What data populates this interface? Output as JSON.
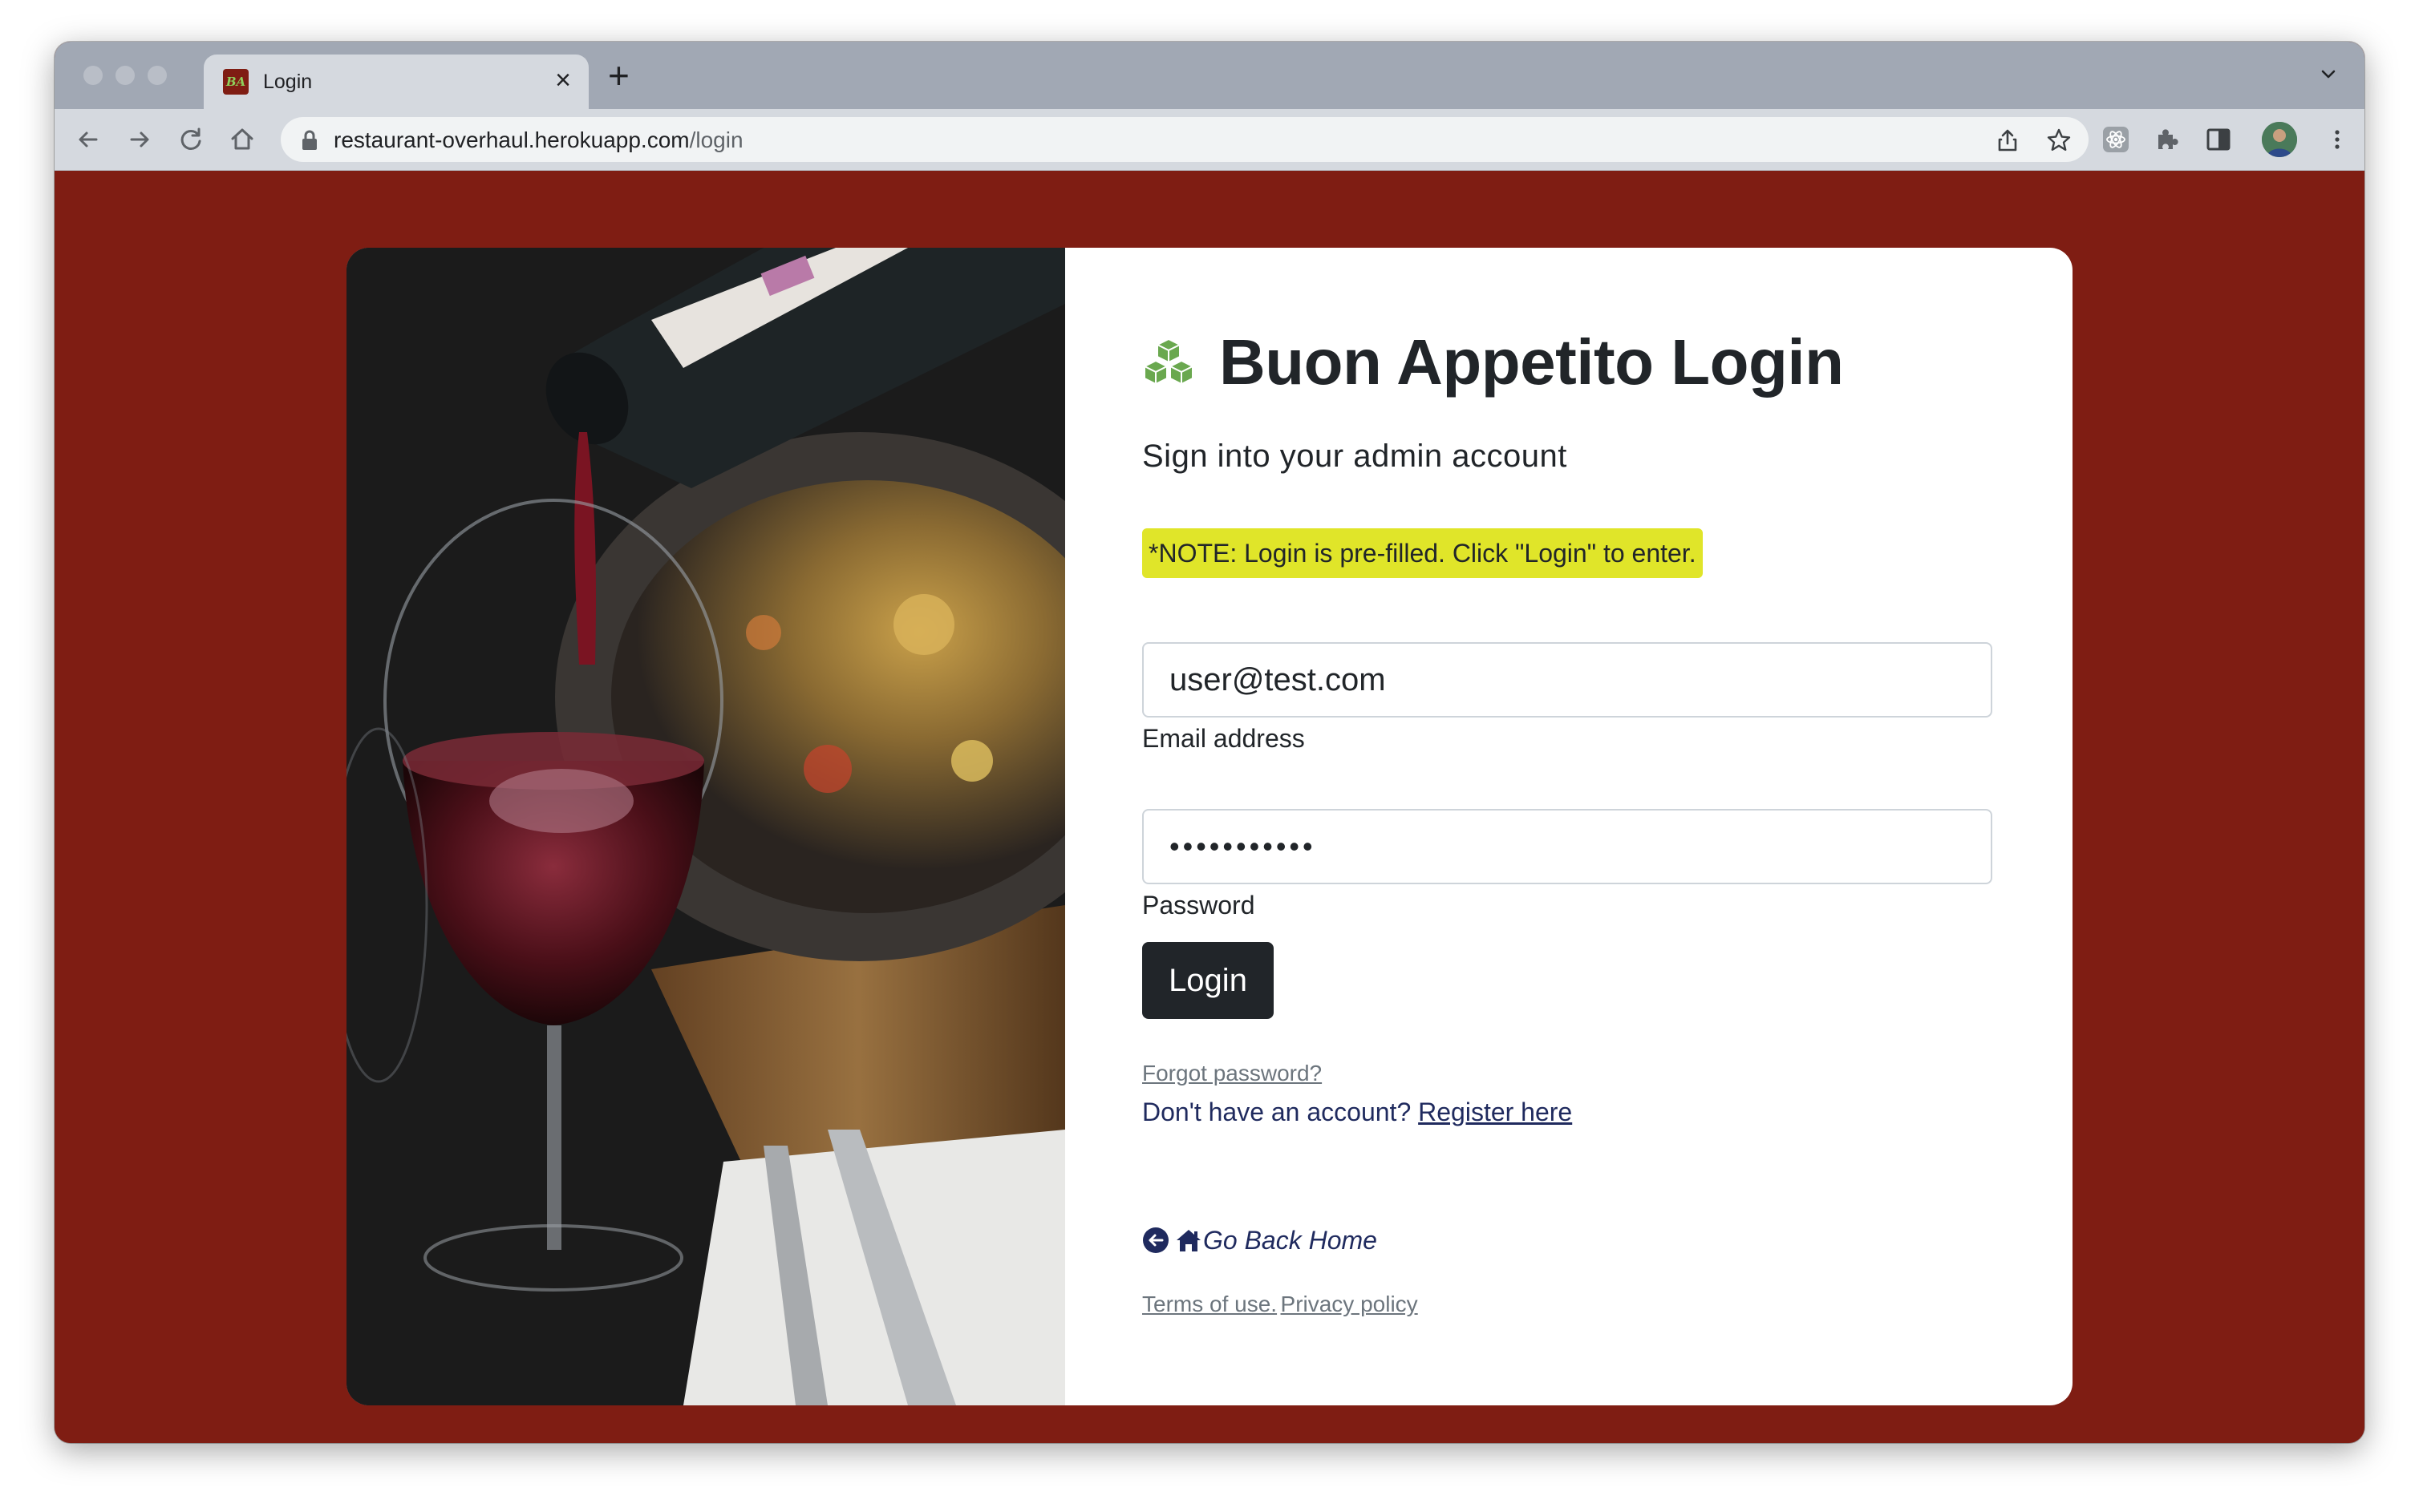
{
  "browser": {
    "tab": {
      "title": "Login",
      "favicon_text": "BA"
    },
    "url": {
      "host": "restaurant-overhaul.herokuapp.com",
      "path": "/login"
    }
  },
  "login": {
    "title": "Buon Appetito Login",
    "subtitle": "Sign into your admin account",
    "note": "*NOTE: Login is pre-filled. Click \"Login\" to enter.",
    "email": {
      "value": "user@test.com",
      "label": "Email address"
    },
    "password": {
      "value": "password123",
      "label": "Password"
    },
    "submit_label": "Login",
    "forgot_password": "Forgot password?",
    "register_prompt": "Don't have an account?",
    "register_link": "Register here",
    "back_home": "Go Back Home",
    "terms": "Terms of use.",
    "privacy": "Privacy policy"
  },
  "colors": {
    "page_background": "#7f1d13",
    "note_highlight": "#e0e529",
    "button": "#212529",
    "link_navy": "#1f2a5e",
    "cube_green": "#6aa84f"
  },
  "icons": [
    "cubes-icon",
    "arrow-left-circle-icon",
    "house-icon",
    "lock-icon",
    "share-icon",
    "star-icon",
    "extensions-icon",
    "sidebar-icon",
    "kebab-menu-icon"
  ]
}
